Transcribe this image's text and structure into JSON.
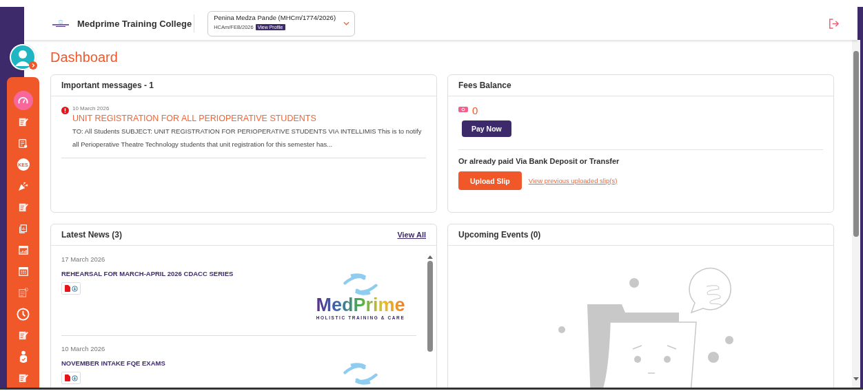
{
  "header": {
    "college_name": "Medprime Training College",
    "profile": {
      "name": "Penina Medza Pande (MHCm/1774/2026)",
      "cohort": "HCAm/FEB/2026",
      "view_profile": "View Profile"
    }
  },
  "sidebar": {
    "items": [
      {
        "selected": true,
        "disabled": false
      },
      {
        "selected": false,
        "disabled": false
      },
      {
        "selected": false,
        "disabled": false
      },
      {
        "selected": false,
        "disabled": false,
        "label": "KES"
      },
      {
        "selected": false,
        "disabled": false
      },
      {
        "selected": false,
        "disabled": false
      },
      {
        "selected": false,
        "disabled": false
      },
      {
        "selected": false,
        "disabled": false
      },
      {
        "selected": false,
        "disabled": false
      },
      {
        "selected": false,
        "disabled": true
      },
      {
        "selected": false,
        "disabled": false
      },
      {
        "selected": false,
        "disabled": false
      },
      {
        "selected": false,
        "disabled": false
      },
      {
        "selected": false,
        "disabled": false
      }
    ]
  },
  "page_title": "Dashboard",
  "messages": {
    "title": "Important messages - 1",
    "items": [
      {
        "important": true,
        "date": "10 March 2026",
        "title": "UNIT REGISTRATION FOR ALL PERIOPERATIVE STUDENTS",
        "body": "TO: All Students SUBJECT: UNIT REGISTRATION FOR PERIOPERATIVE STUDENTS VIA INTELLIMIS This is to notify all Perioperative Theatre Technology students that unit registration for this semester has..."
      }
    ]
  },
  "fees": {
    "title": "Fees Balance",
    "amount": "0",
    "pay_button": "Pay Now",
    "alt_text": "Or already paid Via Bank Deposit or Transfer",
    "upload_button": "Upload Slip",
    "previous_link": "View previous uploaded slip(s)"
  },
  "news": {
    "title": "Latest News (3)",
    "view_all": "View All",
    "items": [
      {
        "date": "17 March 2026",
        "title": "REHEARSAL FOR MARCH-APRIL 2026 CDACC SERIES",
        "wordmark": "MedPrime",
        "tagline": "HOLISTIC TRAINING & CARE"
      },
      {
        "date": "10 March 2026",
        "title": "NOVEMBER INTAKE FQE EXAMS"
      }
    ]
  },
  "events": {
    "title": "Upcoming Events (0)"
  }
}
